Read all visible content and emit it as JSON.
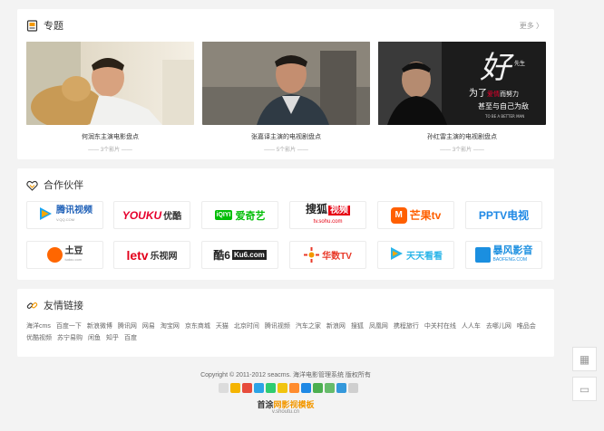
{
  "topics": {
    "title": "专题",
    "more": "更多 〉",
    "items": [
      {
        "title": "何润东主演电影盘点",
        "count": "—— 3个影片 ——"
      },
      {
        "title": "张嘉译主演的电视剧盘点",
        "count": "—— 5个影片 ——"
      },
      {
        "title": "孙红雷主演的电视剧盘点",
        "count": "—— 3个影片 ——"
      }
    ],
    "poster_text": {
      "big": "为了",
      "mid": "爱情",
      "tail": "而努力",
      "line2": "甚至与自己为敌",
      "eng": "TO BE A BETTER MAN",
      "ink": "好",
      "small": "先生"
    }
  },
  "partners": {
    "title": "合作伙伴",
    "items": [
      {
        "name": "腾讯视频",
        "sub": "V.QQ.COM",
        "color": "#1d5fb7"
      },
      {
        "name": "YOUKU",
        "sub": "优酷",
        "color": "#e6002d"
      },
      {
        "name": "爱奇艺",
        "sub": "iQIYI",
        "color": "#00be06"
      },
      {
        "name": "搜狐",
        "sub": "视频",
        "sub2": "tv.sohu.com",
        "color": "#e60012"
      },
      {
        "name": "芒果tv",
        "sub": "",
        "color": "#ff5f00"
      },
      {
        "name": "PPTV电视",
        "sub": "",
        "color": "#1e88e5"
      },
      {
        "name": "土豆",
        "sub": "tudou.com",
        "color": "#ff6600"
      },
      {
        "name": "letv",
        "sub": "乐视网",
        "color": "#e3001b"
      },
      {
        "name": "酷6",
        "sub": "Ku6.com",
        "color": "#222222"
      },
      {
        "name": "华数TV",
        "sub": "",
        "color": "#e83828"
      },
      {
        "name": "天天看看",
        "sub": "",
        "color": "#2bb5e8"
      },
      {
        "name": "暴风影音",
        "sub": "BAOFENG.COM",
        "color": "#1b8fe0"
      }
    ]
  },
  "links": {
    "title": "友情链接",
    "items": [
      "海洋cms",
      "百度一下",
      "新浪微博",
      "腾讯网",
      "网易",
      "淘宝网",
      "京东商城",
      "天猫",
      "北京时间",
      "腾讯视频",
      "汽车之家",
      "新浪网",
      "搜狐",
      "凤凰网",
      "携程旅行",
      "中关村在线",
      "人人车",
      "去哪儿网",
      "唯品会",
      "优酷视频",
      "苏宁易购",
      "闲鱼",
      "知乎",
      "百度"
    ]
  },
  "footer": {
    "copyright": "Copyright © 2011-2012 seacms. 海洋电影管理系统 版权所有",
    "logo_a": "首涂",
    "logo_b": "网影视模板",
    "url": "v.shoutu.cn",
    "share_colors": [
      "#dcdcdc",
      "#f5b400",
      "#e74c3c",
      "#2ca3e6",
      "#2ecc71",
      "#f1c40f",
      "#ff8c2e",
      "#1e88e5",
      "#4caf50",
      "#66bb6a",
      "#3498db",
      "#cfcfcf"
    ]
  },
  "sidebar": {
    "qr": "▦",
    "chat": "▭"
  }
}
